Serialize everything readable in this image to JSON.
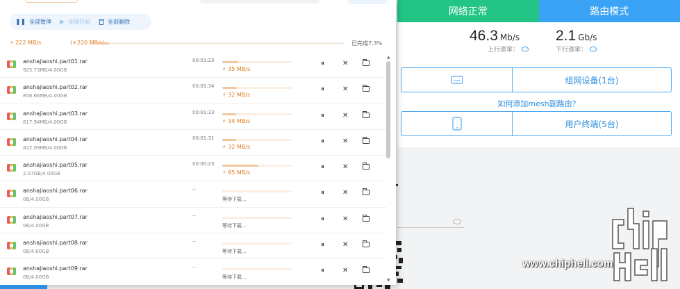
{
  "download_panel": {
    "toolbar": {
      "pause_all": "全部暂停",
      "start_all": "全部开始",
      "delete_all": "全部删除",
      "pause_icon": "pause-icon",
      "play_icon": "play-icon",
      "trash_icon": "trash-icon"
    },
    "summary": {
      "speed": "222 MB/s",
      "speed_delta": "(+220 MB/s)",
      "completed": "已完成7.3%",
      "progress": 0.073
    },
    "files": [
      {
        "name": "anshajiaoshi.part01.rar",
        "size": "925.73MB/4.00GB",
        "time": "00:01:23",
        "speed": "35 MB/s",
        "progress": 0.23
      },
      {
        "name": "anshajiaoshi.part02.rar",
        "size": "858.66MB/4.00GB",
        "time": "00:01:34",
        "speed": "32 MB/s",
        "progress": 0.21
      },
      {
        "name": "anshajiaoshi.part03.rar",
        "size": "817.94MB/4.00GB",
        "time": "00:01:33",
        "speed": "34 MB/s",
        "progress": 0.2
      },
      {
        "name": "anshajiaoshi.part04.rar",
        "size": "822.09MB/4.00GB",
        "time": "00:01:31",
        "speed": "32 MB/s",
        "progress": 0.2
      },
      {
        "name": "anshajiaoshi.part05.rar",
        "size": "2.07GB/4.00GB",
        "time": "00:00:23",
        "speed": "85 MB/s",
        "progress": 0.52
      },
      {
        "name": "anshajiaoshi.part06.rar",
        "size": "0B/4.00GB",
        "time": "--",
        "wait": "等待下载...",
        "progress": 0
      },
      {
        "name": "anshajiaoshi.part07.rar",
        "size": "0B/4.00GB",
        "time": "--",
        "wait": "等待下载...",
        "progress": 0
      },
      {
        "name": "anshajiaoshi.part08.rar",
        "size": "0B/4.00GB",
        "time": "--",
        "wait": "等待下载...",
        "progress": 0
      },
      {
        "name": "anshajiaoshi.part09.rar",
        "size": "0B/4.00GB",
        "time": "--",
        "wait": "等待下载...",
        "progress": 0
      }
    ],
    "row_actions": {
      "pause": "⏸",
      "close": "✕"
    }
  },
  "router": {
    "tabs": [
      "网络正常",
      "路由模式"
    ],
    "upload": {
      "value": "46.3",
      "unit": "Mb/s",
      "label": "上行速率："
    },
    "download": {
      "value": "2.1",
      "unit": "Gb/s",
      "label": "下行速率："
    },
    "mesh_card": "组网设备(1台)",
    "mesh_link": "如何添加mesh副路由？",
    "terminal_card": "用户终端(5台)"
  },
  "watermark": {
    "url": "www.chiphell.com",
    "logo_text": "chip hell"
  },
  "colors": {
    "green": "#22c585",
    "blue": "#3aa3f5",
    "orange": "#e07b20"
  }
}
